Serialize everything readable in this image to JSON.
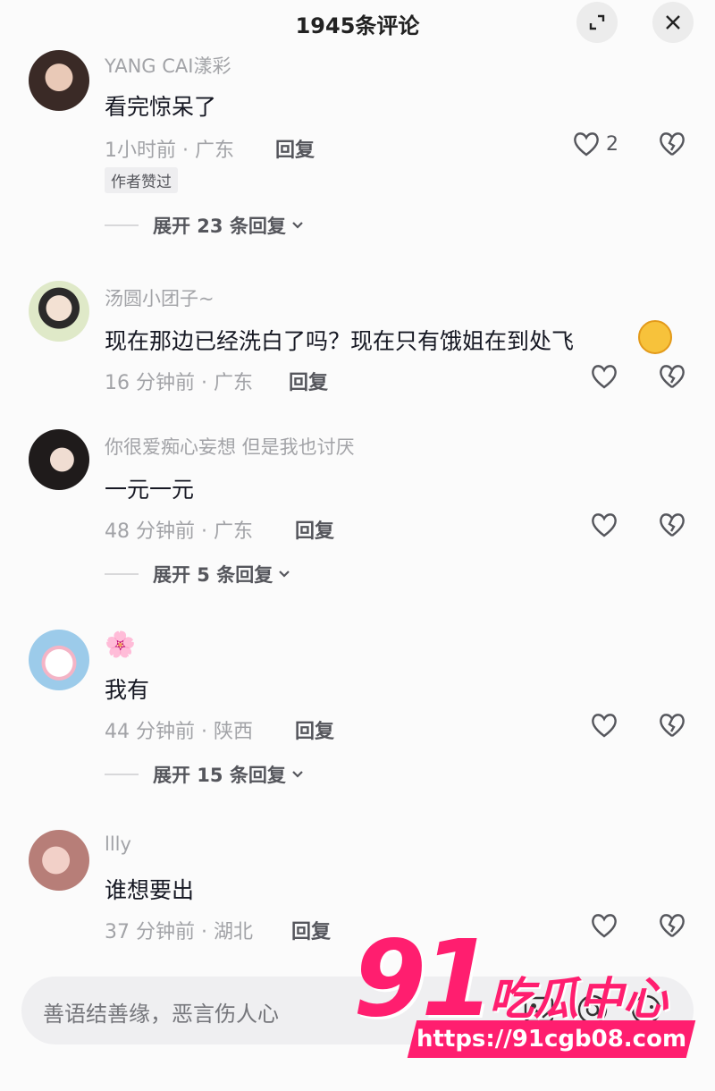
{
  "header": {
    "title": "1945条评论"
  },
  "comments": [
    {
      "username": "YANG CAI漾彩",
      "text": "看完惊呆了",
      "time_location": "1小时前 · 广东",
      "reply_label": "回复",
      "like_count": "2",
      "badge": "作者赞过",
      "expand": "展开 23 条回复"
    },
    {
      "username": "汤圆小团子~",
      "text": "现在那边已经洗白了吗？现在只有饿姐在到处飞",
      "time_location": "16 分钟前 · 广东",
      "reply_label": "回复"
    },
    {
      "username": "你很爱痴心妄想 但是我也讨厌",
      "text": "一元一元",
      "time_location": "48 分钟前 · 广东",
      "reply_label": "回复",
      "expand": "展开 5 条回复"
    },
    {
      "username": "🌸",
      "text": "我有",
      "time_location": "44 分钟前 · 陕西",
      "reply_label": "回复",
      "expand": "展开 15 条回复"
    },
    {
      "username": "llly",
      "text": "谁想要出",
      "time_location": "37 分钟前 · 湖北",
      "reply_label": "回复"
    }
  ],
  "input": {
    "placeholder": "善语结善缘，恶言伤人心"
  },
  "watermark": {
    "number": "91",
    "name": "吃瓜中心",
    "url": "https://91cgb08.com"
  },
  "colors": {
    "accent": "#ff1e6f",
    "text": "#161823",
    "meta": "#a2a3a7"
  },
  "icons": [
    "expand-icon",
    "close-icon",
    "heart-icon",
    "broken-heart-icon",
    "chevron-down-icon",
    "at-icon",
    "emoji-icon",
    "image-icon"
  ]
}
